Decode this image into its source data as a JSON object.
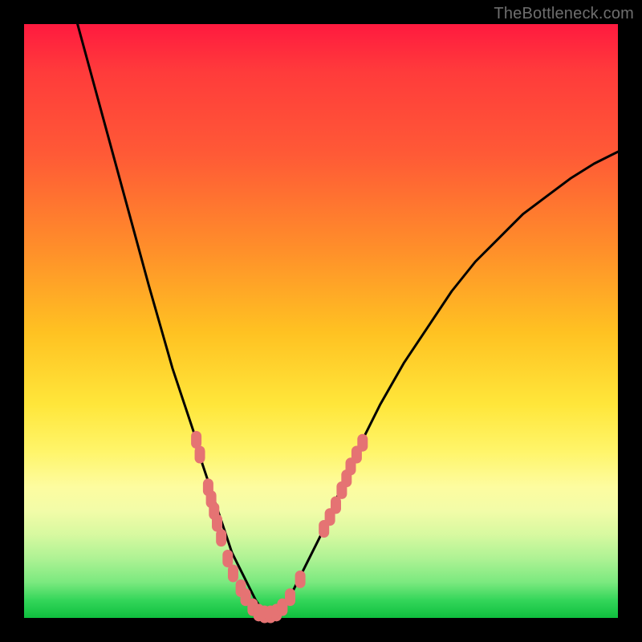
{
  "watermark": "TheBottleneck.com",
  "colors": {
    "background": "#000000",
    "curve": "#000000",
    "marker_fill": "#e57373",
    "marker_stroke": "#d46a6a",
    "gradient_stops": [
      "#ff1a3f",
      "#ff3b3b",
      "#ff5a36",
      "#ff8f2a",
      "#ffc222",
      "#ffe63a",
      "#fff56a",
      "#fdfca0",
      "#f2fca8",
      "#d7f9a0",
      "#aef294",
      "#7be97f",
      "#34d65a",
      "#0fbf3e"
    ]
  },
  "chart_data": {
    "type": "line",
    "title": "",
    "xlabel": "",
    "ylabel": "",
    "xlim": [
      0,
      100
    ],
    "ylim": [
      0,
      100
    ],
    "grid": false,
    "legend": false,
    "series": [
      {
        "name": "bottleneck-curve",
        "x": [
          9,
          12,
          15,
          18,
          21,
          23,
          25,
          27,
          29,
          30,
          31,
          32,
          33,
          34,
          35,
          36,
          37,
          38,
          39,
          40,
          41,
          42,
          43,
          45,
          47,
          50,
          53,
          56,
          60,
          64,
          68,
          72,
          76,
          80,
          84,
          88,
          92,
          96,
          100
        ],
        "y": [
          100,
          89,
          78,
          67,
          56,
          49,
          42,
          36,
          30,
          26,
          23,
          20,
          17,
          14,
          11,
          9,
          7,
          5,
          3,
          1.5,
          0.7,
          0.7,
          1.5,
          4,
          8,
          14,
          21,
          28,
          36,
          43,
          49,
          55,
          60,
          64,
          68,
          71,
          74,
          76.5,
          78.5
        ]
      }
    ],
    "markers": [
      {
        "x": 29.0,
        "y": 30.0
      },
      {
        "x": 29.6,
        "y": 27.5
      },
      {
        "x": 31.0,
        "y": 22.0
      },
      {
        "x": 31.5,
        "y": 20.0
      },
      {
        "x": 32.0,
        "y": 18.0
      },
      {
        "x": 32.5,
        "y": 16.0
      },
      {
        "x": 33.2,
        "y": 13.5
      },
      {
        "x": 34.3,
        "y": 10.0
      },
      {
        "x": 35.2,
        "y": 7.5
      },
      {
        "x": 36.5,
        "y": 5.0
      },
      {
        "x": 37.3,
        "y": 3.5
      },
      {
        "x": 38.5,
        "y": 1.8
      },
      {
        "x": 39.5,
        "y": 0.9
      },
      {
        "x": 40.5,
        "y": 0.6
      },
      {
        "x": 41.5,
        "y": 0.6
      },
      {
        "x": 42.5,
        "y": 0.9
      },
      {
        "x": 43.5,
        "y": 1.8
      },
      {
        "x": 44.8,
        "y": 3.5
      },
      {
        "x": 46.5,
        "y": 6.5
      },
      {
        "x": 50.5,
        "y": 15.0
      },
      {
        "x": 51.5,
        "y": 17.0
      },
      {
        "x": 52.5,
        "y": 19.0
      },
      {
        "x": 53.5,
        "y": 21.5
      },
      {
        "x": 54.3,
        "y": 23.5
      },
      {
        "x": 55.0,
        "y": 25.5
      },
      {
        "x": 56.0,
        "y": 27.5
      },
      {
        "x": 57.0,
        "y": 29.5
      }
    ],
    "annotations": []
  }
}
